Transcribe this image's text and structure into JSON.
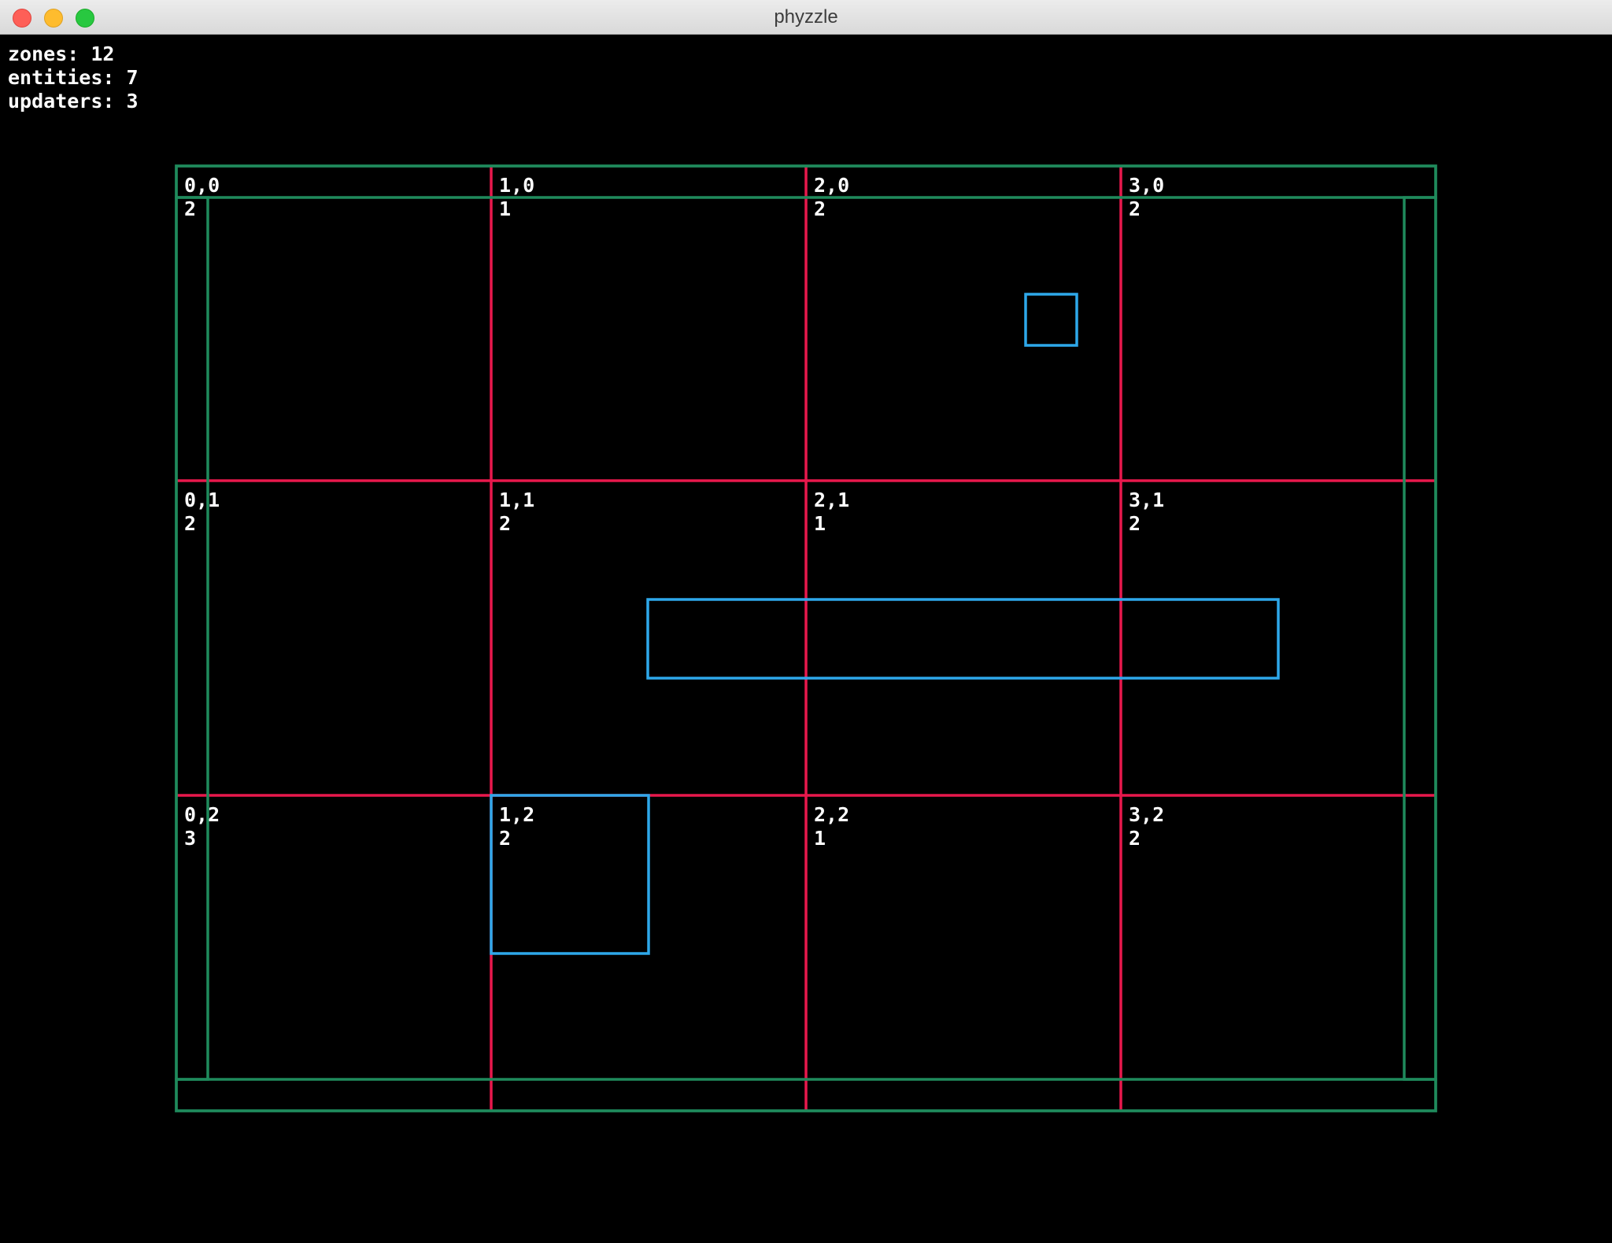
{
  "window": {
    "title": "phyzzle"
  },
  "stats": {
    "zones": "zones: 12",
    "entities": "entities: 7",
    "updaters": "updaters: 3"
  },
  "colors": {
    "zone_grid": "#e8184c",
    "wall": "#1f8a5c",
    "entity": "#2ea8ea"
  },
  "zones": [
    {
      "coord": "0,0",
      "count": "2"
    },
    {
      "coord": "1,0",
      "count": "1"
    },
    {
      "coord": "2,0",
      "count": "2"
    },
    {
      "coord": "3,0",
      "count": "2"
    },
    {
      "coord": "0,1",
      "count": "2"
    },
    {
      "coord": "1,1",
      "count": "2"
    },
    {
      "coord": "2,1",
      "count": "1"
    },
    {
      "coord": "3,1",
      "count": "2"
    },
    {
      "coord": "0,2",
      "count": "3"
    },
    {
      "coord": "1,2",
      "count": "2"
    },
    {
      "coord": "2,2",
      "count": "1"
    },
    {
      "coord": "3,2",
      "count": "2"
    }
  ]
}
